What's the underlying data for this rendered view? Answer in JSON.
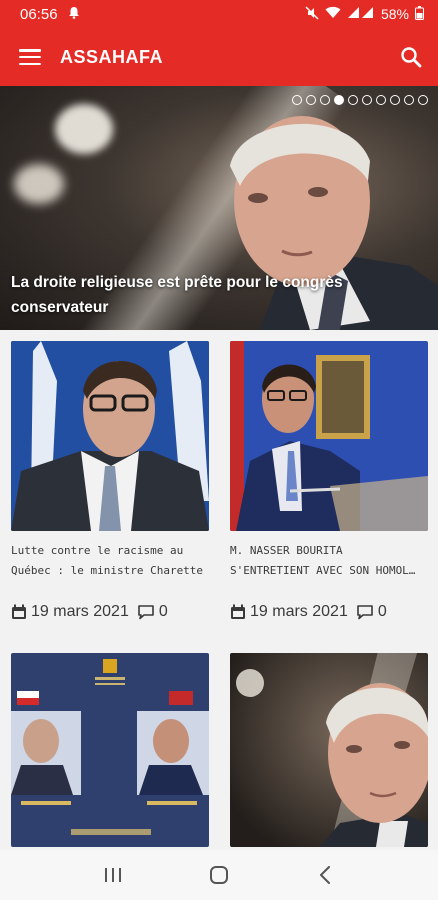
{
  "status": {
    "time": "06:56",
    "battery": "58%"
  },
  "app": {
    "title": "ASSAHAFA"
  },
  "hero": {
    "caption": "La droite religieuse est prête pour le congrès conservateur",
    "slide_count": 10,
    "active_slide": 4
  },
  "cards": [
    {
      "title_line1": "Lutte contre le racisme au",
      "title_line2": "Québec : le ministre Charette ent…",
      "date": "19 mars 2021",
      "comments": "0"
    },
    {
      "title_line1": "M. NASSER BOURITA",
      "title_line2": "S'ENTRETIENT AVEC SON HOMOL…",
      "date": "19 mars 2021",
      "comments": "0"
    }
  ],
  "icons": {
    "bell": "bell-icon",
    "mute": "mute-icon",
    "wifi": "wifi-icon",
    "signal": "signal-icon",
    "battery": "battery-icon",
    "menu": "menu-icon",
    "search": "search-icon",
    "calendar": "calendar-icon",
    "comment": "comment-icon",
    "recents": "recents-icon",
    "home": "home-icon",
    "back": "back-icon"
  },
  "colors": {
    "brand": "#e52b26",
    "text": "#3a3a3a",
    "background": "#f2f2f2"
  }
}
